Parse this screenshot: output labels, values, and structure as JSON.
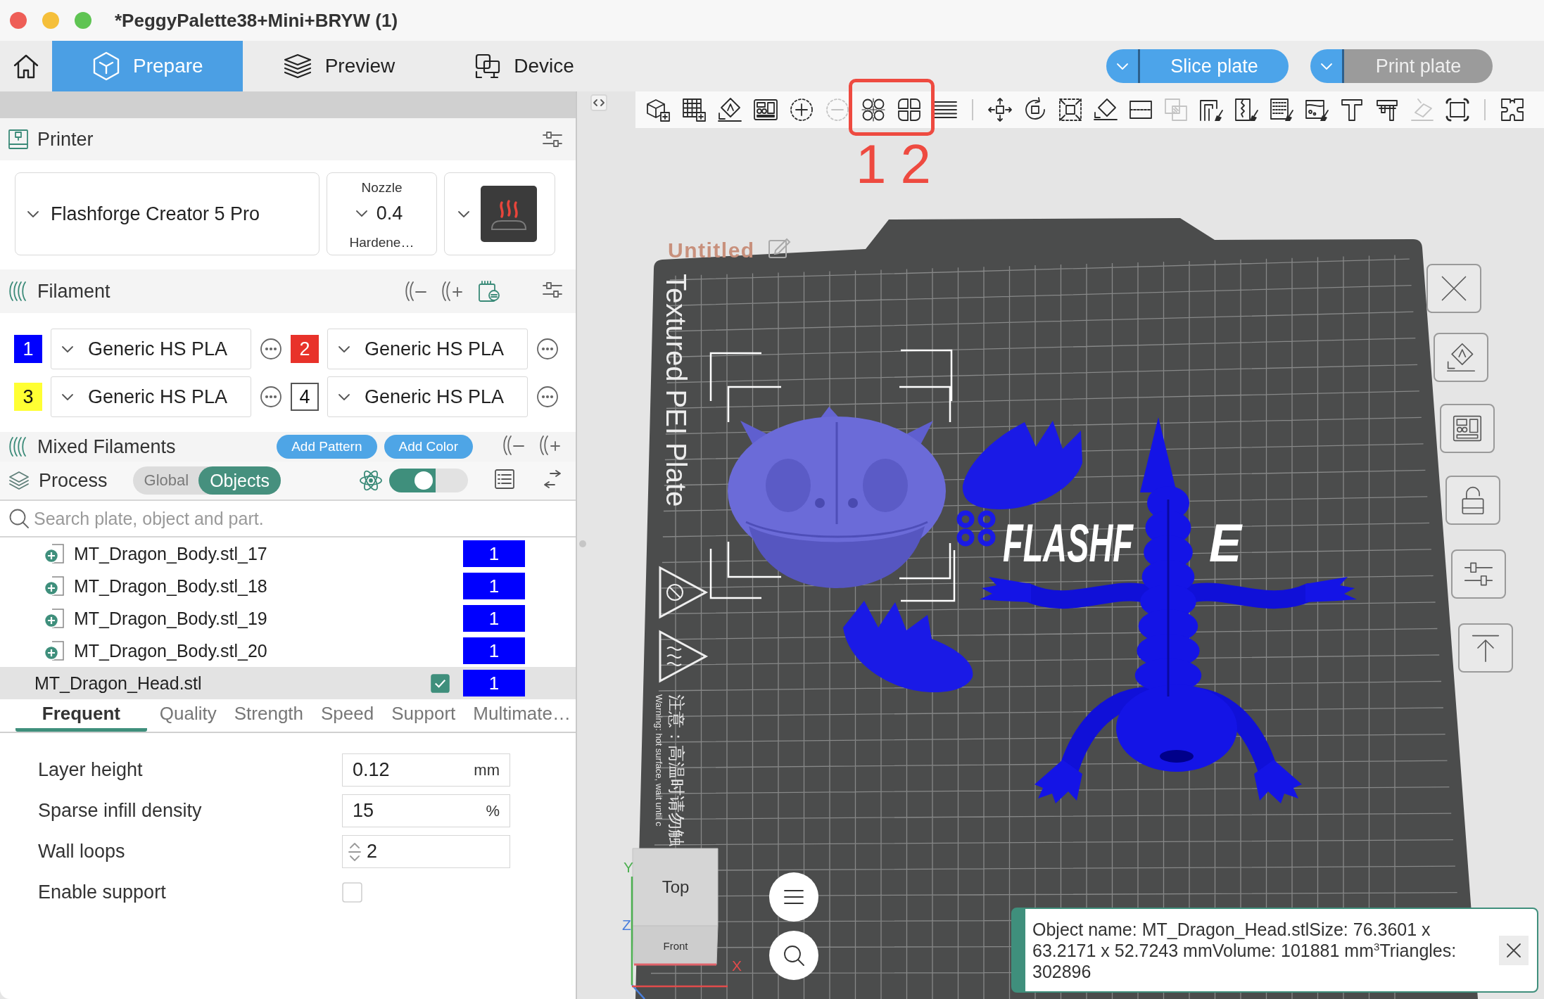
{
  "window": {
    "title": "*PeggyPalette38+Mini+BRYW (1)"
  },
  "tabs": [
    {
      "label": "Prepare",
      "selected": true
    },
    {
      "label": "Preview",
      "selected": false
    },
    {
      "label": "Device",
      "selected": false
    }
  ],
  "actions": [
    {
      "label": "Slice plate",
      "disabled": false
    },
    {
      "label": "Print plate",
      "disabled": true
    }
  ],
  "sidebar": {
    "printer": {
      "title": "Printer",
      "model": "Flashforge Creator 5 Pro",
      "nozzle_label": "Nozzle",
      "nozzle": "0.4",
      "nozzle_type": "Hardene…"
    },
    "filament": {
      "title": "Filament",
      "slots": [
        {
          "number": "1",
          "color": "#0000ff",
          "material": "Generic HS PLA"
        },
        {
          "number": "2",
          "color": "#e8322a",
          "material": "Generic HS PLA"
        },
        {
          "number": "3",
          "color": "#ffff33",
          "material": "Generic HS PLA"
        },
        {
          "number": "4",
          "color": "#ffffff",
          "material": "Generic HS PLA"
        }
      ]
    },
    "mixed_filaments": {
      "title": "Mixed Filaments",
      "buttons": [
        "Add Pattern",
        "Add Color"
      ]
    },
    "process": {
      "title": "Process",
      "modes": [
        {
          "label": "Global",
          "selected": false
        },
        {
          "label": "Objects",
          "selected": true
        }
      ],
      "switch": {
        "on": true
      }
    },
    "search": {
      "placeholder": "Search plate, object and part."
    },
    "objects": [
      {
        "kind": "part",
        "name": "MT_Dragon_Body.stl_17",
        "filament": "1",
        "color": "#0000ff",
        "selected": false,
        "checked": false
      },
      {
        "kind": "part",
        "name": "MT_Dragon_Body.stl_18",
        "filament": "1",
        "color": "#0000ff",
        "selected": false,
        "checked": false
      },
      {
        "kind": "part",
        "name": "MT_Dragon_Body.stl_19",
        "filament": "1",
        "color": "#0000ff",
        "selected": false,
        "checked": false
      },
      {
        "kind": "part",
        "name": "MT_Dragon_Body.stl_20",
        "filament": "1",
        "color": "#0000ff",
        "selected": false,
        "checked": false
      },
      {
        "kind": "object",
        "name": "MT_Dragon_Head.stl",
        "filament": "1",
        "color": "#0000ff",
        "selected": true,
        "checked": true
      }
    ],
    "setting_tabs": [
      {
        "label": "Frequent",
        "selected": true
      },
      {
        "label": "Quality",
        "selected": false
      },
      {
        "label": "Strength",
        "selected": false
      },
      {
        "label": "Speed",
        "selected": false
      },
      {
        "label": "Support",
        "selected": false
      },
      {
        "label": "Multimate…",
        "selected": false
      }
    ],
    "settings": [
      {
        "kind": "number",
        "label": "Layer height",
        "value": "0.12",
        "unit": "mm"
      },
      {
        "kind": "number",
        "label": "Sparse infill density",
        "value": "15",
        "unit": "%"
      },
      {
        "kind": "spin",
        "label": "Wall loops",
        "value": "2"
      },
      {
        "kind": "checkbox",
        "label": "Enable support",
        "checked": false
      }
    ]
  },
  "viewport": {
    "toolbar": {
      "groups": [
        [
          {
            "disabled": false
          },
          {
            "disabled": false
          },
          {
            "disabled": false
          },
          {
            "disabled": false
          },
          {
            "disabled": false
          },
          {
            "disabled": true
          },
          {
            "disabled": false
          },
          {
            "disabled": false
          },
          {
            "disabled": false
          }
        ],
        [
          {
            "disabled": false
          },
          {
            "disabled": false
          },
          {
            "disabled": false
          },
          {
            "disabled": false
          },
          {
            "disabled": false
          },
          {
            "disabled": true
          },
          {
            "disabled": false
          },
          {
            "disabled": false
          },
          {
            "disabled": false
          },
          {
            "disabled": false
          },
          {
            "disabled": false
          },
          {
            "disabled": false
          },
          {
            "disabled": true
          },
          {
            "disabled": false
          }
        ],
        [
          {
            "disabled": false
          }
        ]
      ]
    },
    "annotation": {
      "labels": [
        "1",
        "2"
      ]
    },
    "plate": {
      "name": "Untitled",
      "surface": "Textured PEI Plate",
      "logo": [
        "FLASHF",
        "E"
      ],
      "warnings": [
        "注意：高温时请勿触",
        "Warning: hot surface, wait until c"
      ]
    },
    "view_cube": {
      "faces": [
        "Top",
        "Front"
      ],
      "axes": [
        {
          "label": "Y",
          "color": "#4caf50"
        },
        {
          "label": "Z",
          "color": "#4a7fdc"
        },
        {
          "label": "X",
          "color": "#e24b4b"
        }
      ]
    },
    "object_info": {
      "text": "Object name: MT_Dragon_Head.stlSize: 76.3601 x 63.2171 x 52.7243 mmVolume: 101881 mm$^{3}$Triangles: 302896"
    }
  }
}
